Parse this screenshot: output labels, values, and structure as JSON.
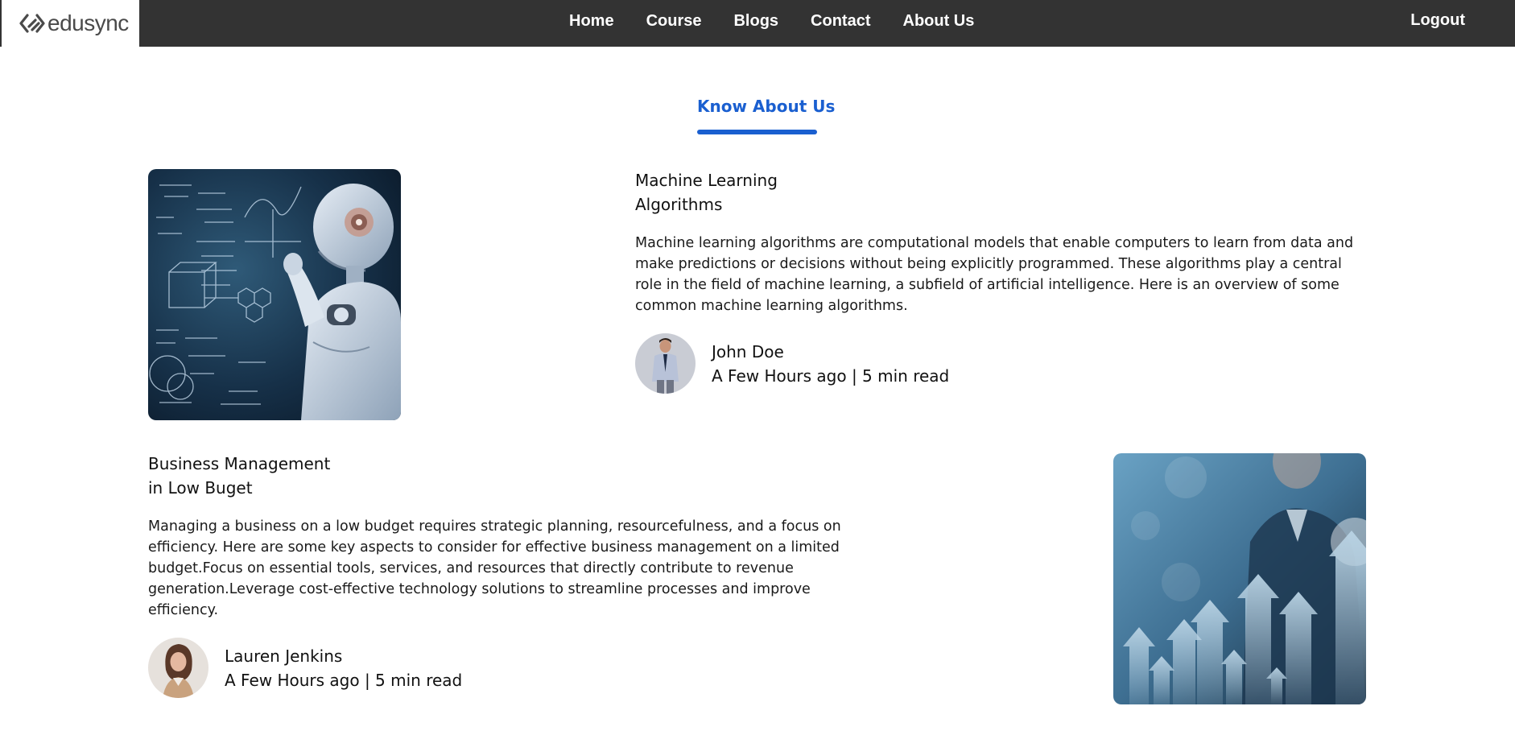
{
  "brand": {
    "name": "edusync",
    "logo_icon": "edusync-logo-icon"
  },
  "nav": {
    "items": [
      {
        "label": "Home"
      },
      {
        "label": "Course"
      },
      {
        "label": "Blogs"
      },
      {
        "label": "Contact"
      },
      {
        "label": "About Us"
      }
    ],
    "logout_label": "Logout"
  },
  "section": {
    "title": "Know About Us",
    "accent_color": "#1a5fd0"
  },
  "posts": [
    {
      "title_line1": "Machine Learning",
      "title_line2": "Algorithms",
      "body": "Machine learning algorithms are computational models that enable computers to learn from data and make predictions or decisions without being explicitly programmed. These algorithms play a central role in the field of machine learning, a subfield of artificial intelligence. Here is an overview of some common machine learning algorithms.",
      "image_icon": "robot-thinking-image",
      "author": {
        "name": "John Doe",
        "info": "A Few Hours ago | 5 min read",
        "avatar_icon": "man-in-suit-avatar"
      }
    },
    {
      "title_line1": "Business Management",
      "title_line2": "in Low Buget",
      "body": "Managing a business on a low budget requires strategic planning, resourcefulness, and a focus on efficiency. Here are some key aspects to consider for effective business management on a limited budget.Focus on essential tools, services, and resources that directly contribute to revenue generation.Leverage cost-effective technology solutions to streamline processes and improve efficiency.",
      "image_icon": "business-growth-arrows-image",
      "author": {
        "name": "Lauren Jenkins",
        "info": "A Few Hours ago | 5 min read",
        "avatar_icon": "woman-portrait-avatar"
      }
    }
  ]
}
